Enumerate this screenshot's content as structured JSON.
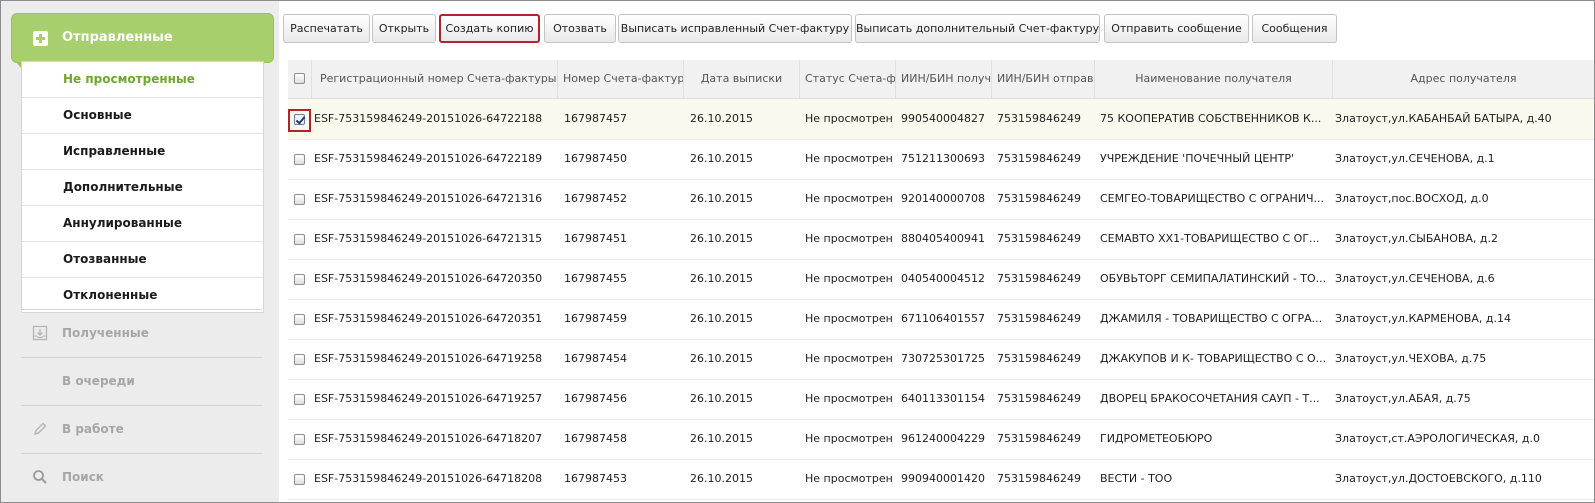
{
  "sidebar": {
    "header": "Отправленные",
    "sub_items": [
      {
        "label": "Не просмотренные",
        "active": true
      },
      {
        "label": "Основные"
      },
      {
        "label": "Исправленные"
      },
      {
        "label": "Дополнительные"
      },
      {
        "label": "Аннулированные"
      },
      {
        "label": "Отозванные"
      },
      {
        "label": "Отклоненные"
      }
    ],
    "sections": [
      {
        "label": "Полученные",
        "icon": "inbox-icon"
      },
      {
        "label": "В очереди",
        "icon": ""
      },
      {
        "label": "В работе",
        "icon": "pencil-icon"
      },
      {
        "label": "Поиск",
        "icon": "search-icon"
      }
    ]
  },
  "toolbar": {
    "print": "Распечатать",
    "open": "Открыть",
    "copy": "Создать копию",
    "revoke": "Отозвать",
    "corrected": "Выписать исправленный Счет-фактуру",
    "additional": "Выписать дополнительный Счет-фактуру",
    "send_message": "Отправить сообщение",
    "messages": "Сообщения"
  },
  "table": {
    "columns": [
      "Регистрационный номер Счета-фактуры",
      "Номер Счета-фактур",
      "Дата выписки",
      "Статус Счета-ф",
      "ИИН/БИН получ",
      "ИИН/БИН отправ",
      "Наименование получателя",
      "Адрес получателя"
    ],
    "rows": [
      {
        "reg": "ESF-753159846249-20151026-64722188",
        "num": "167987457",
        "date": "26.10.2015",
        "status": "Не просмотрен",
        "iin_recv": "990540004827",
        "iin_send": "753159846249",
        "name": "75 КООПЕРАТИВ СОБСТВЕННИКОВ К...",
        "addr": "Златоуст,ул.КАБАНБАЙ БАТЫРА, д.40",
        "checked": true
      },
      {
        "reg": "ESF-753159846249-20151026-64722189",
        "num": "167987450",
        "date": "26.10.2015",
        "status": "Не просмотрен",
        "iin_recv": "751211300693",
        "iin_send": "753159846249",
        "name": "УЧРЕЖДЕНИЕ 'ПОЧЕЧНЫЙ ЦЕНТР'",
        "addr": "Златоуст,ул.СЕЧЕНОВА, д.1",
        "checked": false
      },
      {
        "reg": "ESF-753159846249-20151026-64721316",
        "num": "167987452",
        "date": "26.10.2015",
        "status": "Не просмотрен",
        "iin_recv": "920140000708",
        "iin_send": "753159846249",
        "name": "СЕМГЕО-ТОВАРИЩЕСТВО С ОГРАНИЧ...",
        "addr": "Златоуст,пос.ВОСХОД, д.0",
        "checked": false
      },
      {
        "reg": "ESF-753159846249-20151026-64721315",
        "num": "167987451",
        "date": "26.10.2015",
        "status": "Не просмотрен",
        "iin_recv": "880405400941",
        "iin_send": "753159846249",
        "name": "СЕМАВТО ХХ1-ТОВАРИЩЕСТВО С ОГ...",
        "addr": "Златоуст,ул.СЫБАНОВА, д.2",
        "checked": false
      },
      {
        "reg": "ESF-753159846249-20151026-64720350",
        "num": "167987455",
        "date": "26.10.2015",
        "status": "Не просмотрен",
        "iin_recv": "040540004512",
        "iin_send": "753159846249",
        "name": "ОБУВЬТОРГ СЕМИПАЛАТИНСКИЙ - ТО...",
        "addr": "Златоуст,ул.СЕЧЕНОВА, д.6",
        "checked": false
      },
      {
        "reg": "ESF-753159846249-20151026-64720351",
        "num": "167987459",
        "date": "26.10.2015",
        "status": "Не просмотрен",
        "iin_recv": "671106401557",
        "iin_send": "753159846249",
        "name": "ДЖАМИЛЯ - ТОВАРИЩЕСТВО С ОГРА...",
        "addr": "Златоуст,ул.КАРМЕНОВА, д.14",
        "checked": false
      },
      {
        "reg": "ESF-753159846249-20151026-64719258",
        "num": "167987454",
        "date": "26.10.2015",
        "status": "Не просмотрен",
        "iin_recv": "730725301725",
        "iin_send": "753159846249",
        "name": "ДЖАКУПОВ И К- ТОВАРИЩЕСТВО С О...",
        "addr": "Златоуст,ул.ЧЕХОВА, д.75",
        "checked": false
      },
      {
        "reg": "ESF-753159846249-20151026-64719257",
        "num": "167987456",
        "date": "26.10.2015",
        "status": "Не просмотрен",
        "iin_recv": "640113301154",
        "iin_send": "753159846249",
        "name": "ДВОРЕЦ БРАКОСОЧЕТАНИЯ САУП - Т...",
        "addr": "Златоуст,ул.АБАЯ, д.75",
        "checked": false
      },
      {
        "reg": "ESF-753159846249-20151026-64718207",
        "num": "167987458",
        "date": "26.10.2015",
        "status": "Не просмотрен",
        "iin_recv": "961240004229",
        "iin_send": "753159846249",
        "name": "ГИДРОМЕТЕОБЮРО",
        "addr": "Златоуст,ст.АЭРОЛОГИЧЕСКАЯ, д.0",
        "checked": false
      },
      {
        "reg": "ESF-753159846249-20151026-64718208",
        "num": "167987453",
        "date": "26.10.2015",
        "status": "Не просмотрен",
        "iin_recv": "990940001420",
        "iin_send": "753159846249",
        "name": "ВЕСТИ - ТОО",
        "addr": "Златоуст,ул.ДОСТОЕВСКОГО, д.110",
        "checked": false
      }
    ]
  },
  "colors": {
    "accent_green": "#a7cf6e",
    "highlight_red": "#b3232d"
  }
}
